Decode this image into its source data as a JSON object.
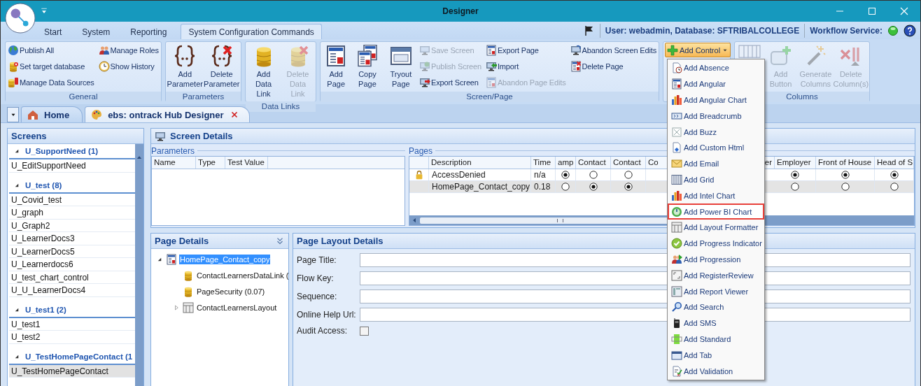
{
  "window": {
    "title": "Designer"
  },
  "ribbon_tabs": [
    {
      "label": "Start",
      "selected": false
    },
    {
      "label": "System",
      "selected": false
    },
    {
      "label": "Reporting",
      "selected": false
    },
    {
      "label": "System Configuration Commands",
      "selected": true
    }
  ],
  "status": {
    "user": "User: webadmin, Database: SFTRIBALCOLLEGE",
    "workflow_label": "Workflow Service:"
  },
  "ribbon_groups": [
    {
      "label": "General",
      "items": [
        {
          "kind": "small",
          "label": "Publish All",
          "disabled": false
        },
        {
          "kind": "small",
          "label": "Set target database",
          "disabled": false
        },
        {
          "kind": "small",
          "label": "Manage Data Sources",
          "disabled": false
        },
        {
          "kind": "small",
          "label": "Manage Roles",
          "disabled": false
        },
        {
          "kind": "small",
          "label": "Show History",
          "disabled": false
        }
      ]
    },
    {
      "label": "Parameters",
      "items": [
        {
          "kind": "large",
          "label": "Add Parameter",
          "disabled": false
        },
        {
          "kind": "large",
          "label": "Delete Parameter",
          "disabled": false
        }
      ]
    },
    {
      "label": "Data Links",
      "items": [
        {
          "kind": "large",
          "label": "Add Data Link",
          "disabled": false
        },
        {
          "kind": "large",
          "label": "Delete Data Link",
          "disabled": true
        }
      ]
    },
    {
      "label": "Screen/Page",
      "items": [
        {
          "kind": "large",
          "label": "Add Page",
          "disabled": false
        },
        {
          "kind": "large",
          "label": "Copy Page",
          "disabled": false
        },
        {
          "kind": "large",
          "label": "Tryout Page",
          "disabled": false
        },
        {
          "kind": "small",
          "label": "Save Screen",
          "disabled": true
        },
        {
          "kind": "small",
          "label": "Publish Screen",
          "disabled": true
        },
        {
          "kind": "small",
          "label": "Export Screen",
          "disabled": false
        },
        {
          "kind": "small",
          "label": "Export Page",
          "disabled": false
        },
        {
          "kind": "small",
          "label": "Import",
          "disabled": false
        },
        {
          "kind": "small",
          "label": "Abandon Page Edits",
          "disabled": true
        },
        {
          "kind": "small",
          "label": "Abandon Screen Edits",
          "disabled": false
        },
        {
          "kind": "small",
          "label": "Delete Page",
          "disabled": false
        }
      ]
    },
    {
      "items": [
        {
          "kind": "dropdown",
          "label": "Add Control",
          "expanded": true
        }
      ]
    },
    {
      "label": "Columns",
      "items": [
        {
          "kind": "large",
          "disabled": true
        },
        {
          "kind": "large",
          "label": "Add Button",
          "disabled": true
        },
        {
          "kind": "large",
          "label": "Generate Columns",
          "disabled": true
        },
        {
          "kind": "large",
          "label": "Delete Column(s)",
          "disabled": true
        }
      ]
    }
  ],
  "doc_tabs": [
    {
      "label": "Home",
      "selected": false,
      "closable": false
    },
    {
      "label": "ebs: ontrack Hub Designer",
      "selected": true,
      "closable": true
    }
  ],
  "screens": {
    "title": "Screens",
    "groups": [
      {
        "label": "U_SupportNeed (1)",
        "expanded": true,
        "items": [
          {
            "label": "U_EditSupportNeed",
            "selected": false
          }
        ]
      },
      {
        "label": "U_test (8)",
        "expanded": true,
        "items": [
          {
            "label": "U_Covid_test",
            "selected": false
          },
          {
            "label": "U_graph",
            "selected": false
          },
          {
            "label": "U_Graph2",
            "selected": false
          },
          {
            "label": "U_LearnerDocs3",
            "selected": false
          },
          {
            "label": "U_LearnerDocs5",
            "selected": false
          },
          {
            "label": "U_Learnerdocs6",
            "selected": false
          },
          {
            "label": "U_test_chart_control",
            "selected": false
          },
          {
            "label": "U_U_LearnerDocs4",
            "selected": false
          }
        ]
      },
      {
        "label": "U_test1 (2)",
        "expanded": true,
        "items": [
          {
            "label": "U_test1",
            "selected": false
          },
          {
            "label": "U_test2",
            "selected": false
          }
        ]
      },
      {
        "label": "U_TestHomePageContact (1",
        "expanded": true,
        "items": [
          {
            "label": "U_TestHomePageContact",
            "selected": true
          }
        ]
      }
    ]
  },
  "screen_details": {
    "title": "Screen Details",
    "parameters": {
      "title": "Parameters",
      "columns": [
        "Name",
        "Type",
        "Test Value"
      ]
    },
    "pages": {
      "title": "Pages",
      "columns": [
        {
          "label": "Description",
          "kind": "text"
        },
        {
          "label": "Time",
          "kind": "text"
        },
        {
          "label": "amp",
          "kind": "radio"
        },
        {
          "label": "Contact",
          "kind": "radio"
        },
        {
          "label": "Contact",
          "kind": "radio"
        },
        {
          "label": "Co",
          "kind": "clipped_end"
        },
        {
          "label": "er",
          "kind": "clipped_start"
        },
        {
          "label": "Employer",
          "kind": "radio"
        },
        {
          "label": "Front of House",
          "kind": "radio"
        },
        {
          "label": "Head of S",
          "kind": "radio"
        }
      ],
      "rows": [
        {
          "locked": true,
          "selected": false,
          "description": "AccessDenied",
          "time": "n/a",
          "choices": [
            {
              "selected": true
            },
            {
              "selected": false
            },
            {
              "selected": false
            },
            {
              "selected": true
            },
            {
              "selected": true
            },
            {
              "selected": true
            }
          ]
        },
        {
          "locked": false,
          "selected": true,
          "description": "HomePage_Contact_copy",
          "time": "0.18",
          "choices": [
            {
              "selected": false
            },
            {
              "selected": true
            },
            {
              "selected": true
            },
            {
              "selected": false
            },
            {
              "selected": false
            },
            {
              "selected": false
            }
          ]
        }
      ]
    }
  },
  "page_details": {
    "title": "Page Details",
    "tree": [
      {
        "label": "HomePage_Contact_copy",
        "selected": true,
        "expanded": true,
        "children": [
          {
            "label": "ContactLearnersDataLink (",
            "selected": false
          },
          {
            "label": "PageSecurity (0.07)",
            "selected": false
          },
          {
            "label": "ContactLearnersLayout",
            "selected": false,
            "expanded": false
          }
        ]
      }
    ]
  },
  "page_layout": {
    "title": "Page Layout Details",
    "fields": [
      {
        "label": "Page Title:",
        "kind": "text"
      },
      {
        "label": "Flow Key:",
        "kind": "text"
      },
      {
        "label": "Sequence:",
        "kind": "text"
      },
      {
        "label": "Online Help Url:",
        "kind": "text"
      },
      {
        "label": "Audit Access:",
        "kind": "checkbox",
        "checked": false
      }
    ]
  },
  "control_menu": {
    "items": [
      {
        "label": "Add Absence",
        "highlighted": false
      },
      {
        "label": "Add Angular",
        "highlighted": false
      },
      {
        "label": "Add Angular Chart",
        "highlighted": false
      },
      {
        "label": "Add Breadcrumb",
        "highlighted": false
      },
      {
        "label": "Add Buzz",
        "highlighted": false
      },
      {
        "label": "Add Custom Html",
        "highlighted": false
      },
      {
        "label": "Add Email",
        "highlighted": false
      },
      {
        "label": "Add Grid",
        "highlighted": false
      },
      {
        "label": "Add Intel Chart",
        "highlighted": false
      },
      {
        "label": "Add Power BI Chart",
        "highlighted": true
      },
      {
        "label": "Add Layout Formatter",
        "highlighted": false
      },
      {
        "label": "Add Progress Indicator",
        "highlighted": false
      },
      {
        "label": "Add Progression",
        "highlighted": false
      },
      {
        "label": "Add RegisterReview",
        "highlighted": false
      },
      {
        "label": "Add Report Viewer",
        "highlighted": false
      },
      {
        "label": "Add Search",
        "highlighted": false
      },
      {
        "label": "Add SMS",
        "highlighted": false
      },
      {
        "label": "Add Standard",
        "highlighted": false
      },
      {
        "label": "Add Tab",
        "highlighted": false
      },
      {
        "label": "Add Validation",
        "highlighted": false
      }
    ]
  }
}
